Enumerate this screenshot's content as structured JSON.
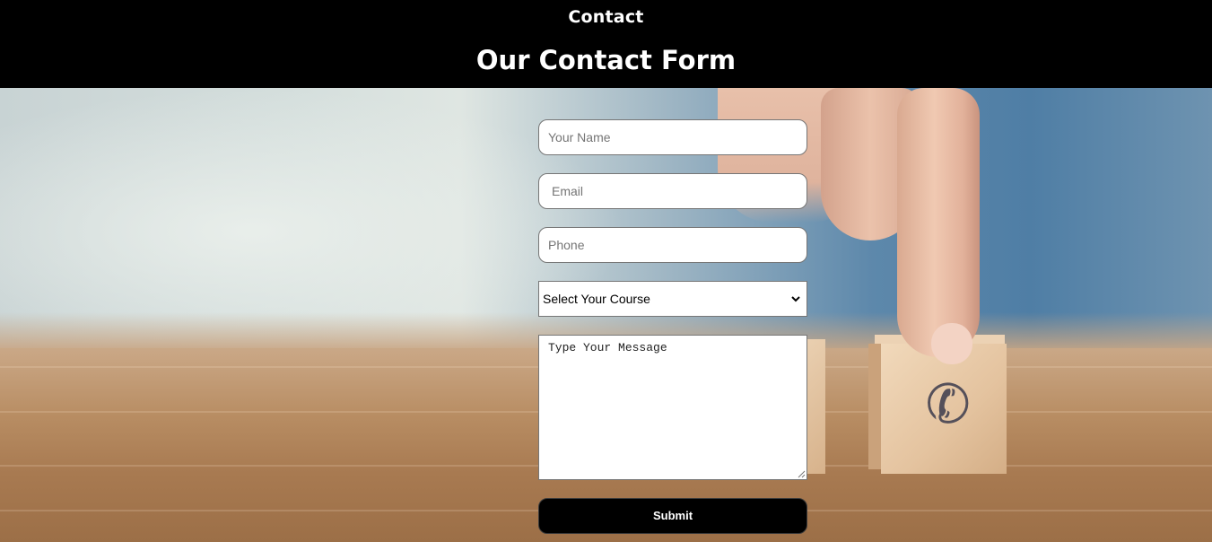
{
  "header": {
    "nav_title": "Contact",
    "form_title": "Our Contact Form"
  },
  "form": {
    "name_placeholder": "Your Name",
    "email_placeholder": "Email",
    "phone_placeholder": "Phone",
    "course_select": {
      "selected": "Select Your Course"
    },
    "message_placeholder": "Type Your Message",
    "submit_label": "Submit"
  },
  "background": {
    "description_icon": "phone-icon",
    "phone_glyph": "✆"
  },
  "colors": {
    "header_bg": "#000000",
    "header_text": "#ffffff",
    "button_bg": "#000000",
    "button_text": "#ffffff"
  }
}
